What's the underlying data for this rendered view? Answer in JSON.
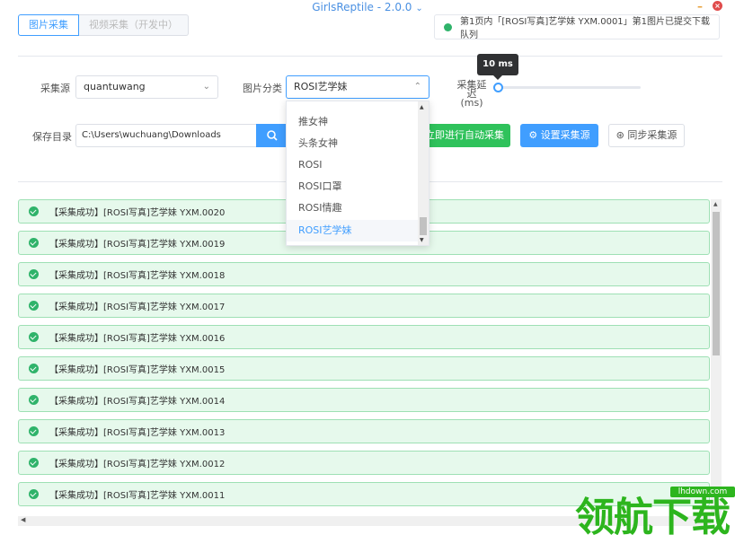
{
  "app": {
    "title": "GirlsReptile - 2.0.0",
    "title_chevron": "⌄"
  },
  "window": {
    "minimize": "–",
    "close": "×"
  },
  "tabs": [
    {
      "label": "图片采集",
      "active": true
    },
    {
      "label": "视频采集（开发中）",
      "active": false
    }
  ],
  "notice": {
    "text": "第1页内「[ROSI写真]艺学妹 YXM.0001」第1图片已提交下载队列"
  },
  "form": {
    "source_label": "采集源",
    "source_value": "quantuwang",
    "category_label": "图片分类",
    "category_value": "ROSI艺学妹",
    "delay_label_line1": "采集延迟",
    "delay_label_line2": "(ms)",
    "delay_tooltip": "10 ms",
    "delay_fraction": 0,
    "save_dir_label": "保存目录",
    "save_dir_value": "C:\\Users\\wuchuang\\Downloads"
  },
  "buttons": {
    "auto_collect": "立即进行自动采集",
    "set_source": "设置采集源",
    "sync_source": "同步采集源"
  },
  "dropdown": {
    "items": [
      "推女神",
      "头条女神",
      "ROSI",
      "ROSI口罩",
      "ROSI情趣",
      "ROSI艺学妹"
    ],
    "selected": "ROSI艺学妹"
  },
  "log": {
    "items": [
      "【采集成功】[ROSI写真]艺学妹 YXM.0020",
      "【采集成功】[ROSI写真]艺学妹 YXM.0019",
      "【采集成功】[ROSI写真]艺学妹 YXM.0018",
      "【采集成功】[ROSI写真]艺学妹 YXM.0017",
      "【采集成功】[ROSI写真]艺学妹 YXM.0016",
      "【采集成功】[ROSI写真]艺学妹 YXM.0015",
      "【采集成功】[ROSI写真]艺学妹 YXM.0014",
      "【采集成功】[ROSI写真]艺学妹 YXM.0013",
      "【采集成功】[ROSI写真]艺学妹 YXM.0012",
      "【采集成功】[ROSI写真]艺学妹 YXM.0011"
    ]
  },
  "watermark": {
    "text": "领航下载",
    "url": "lhdown.com"
  },
  "colors": {
    "primary": "#409eff",
    "success": "#2fc25b",
    "success_bg": "#e6f9ec",
    "watermark": "#2db51e"
  }
}
